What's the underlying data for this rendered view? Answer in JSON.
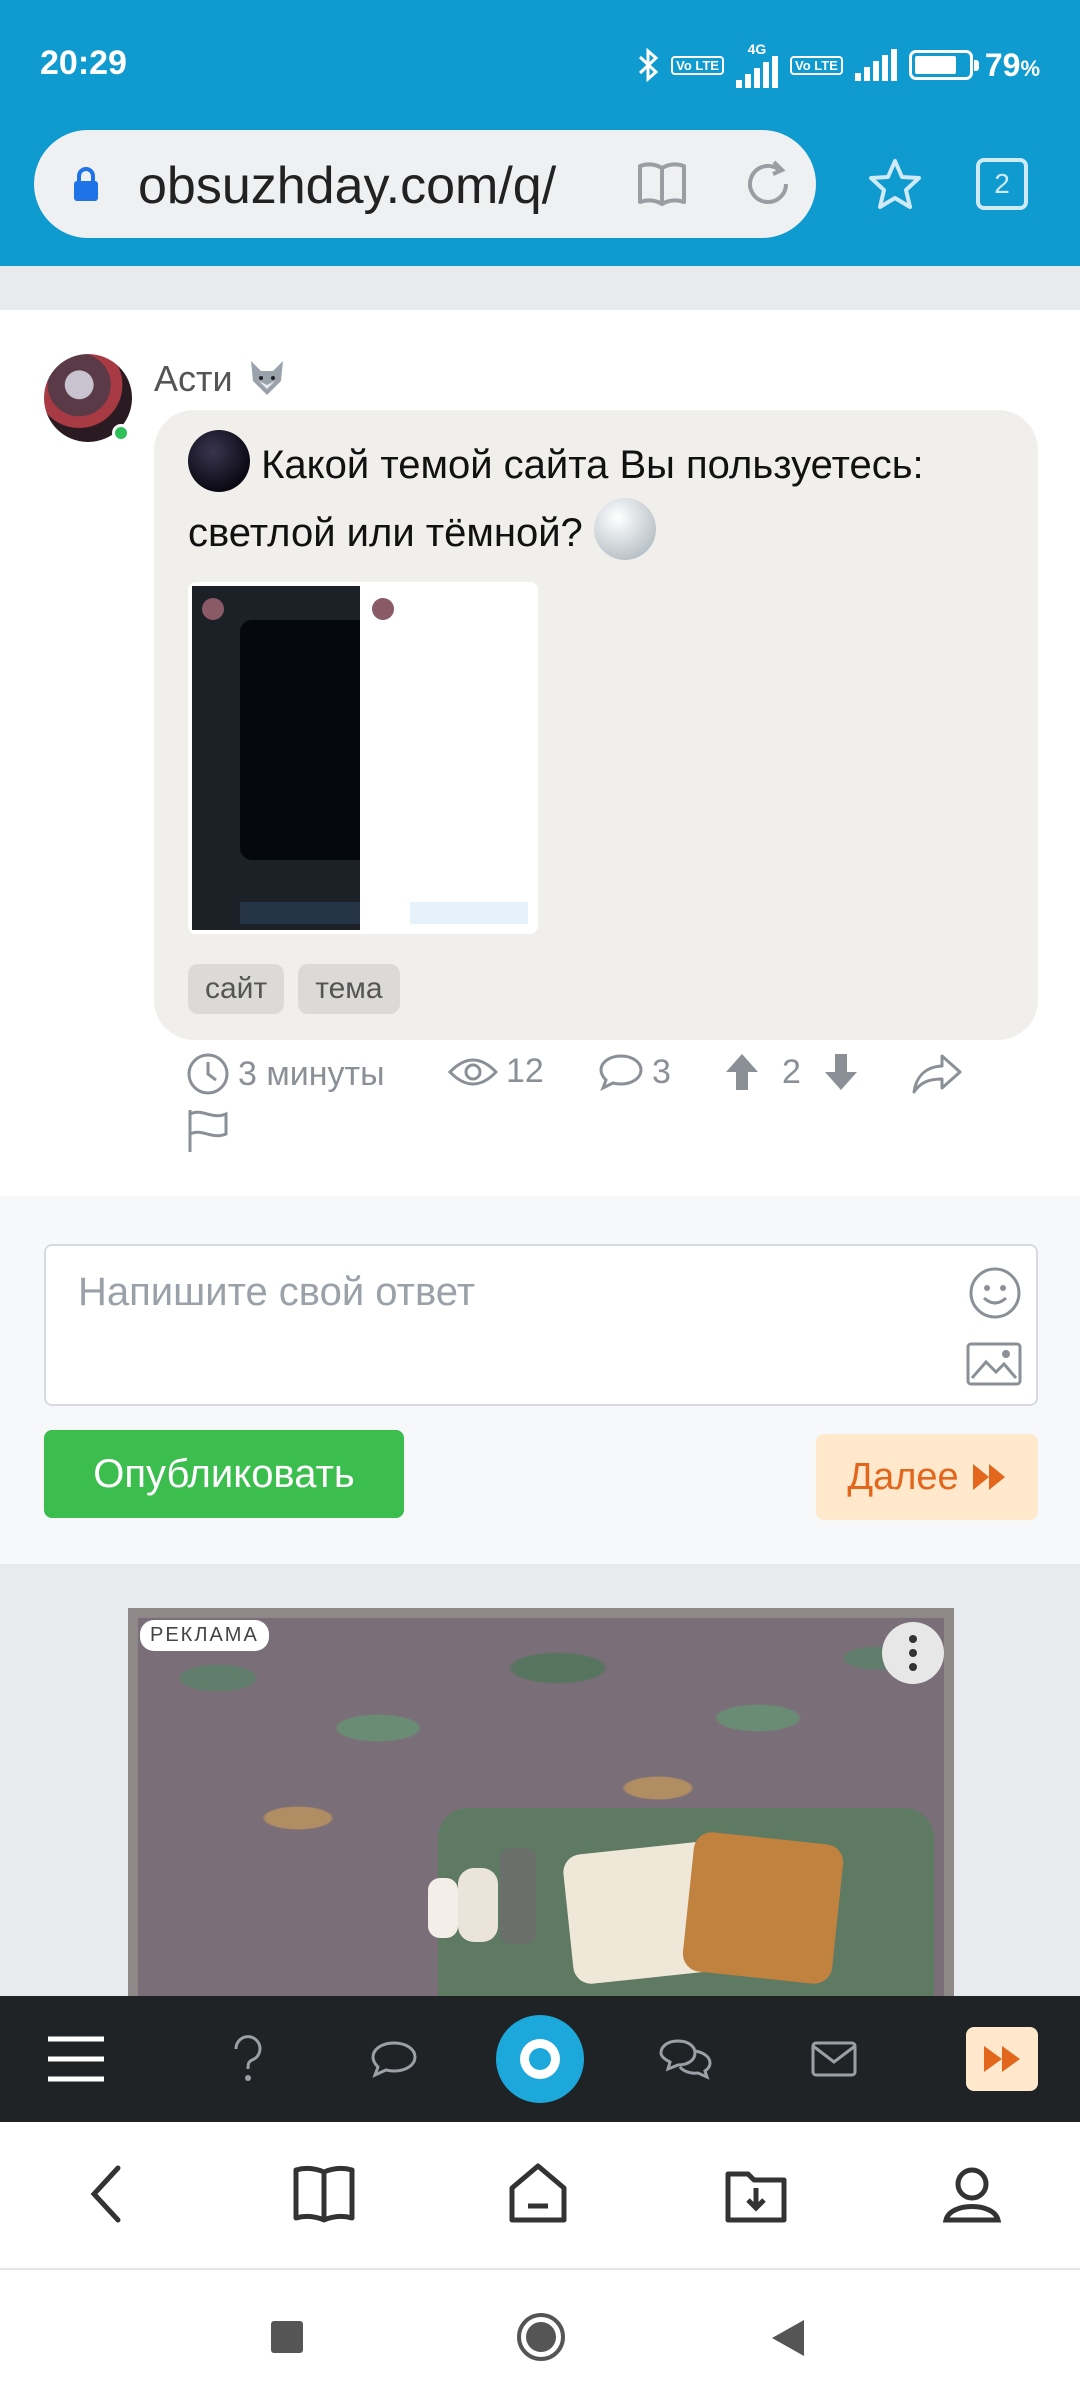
{
  "status_bar": {
    "time": "20:29",
    "battery": "79",
    "battery_unit": "%",
    "network_label": "4G",
    "volte_label": "Vo LTE"
  },
  "browser": {
    "url": "obsuzhday.com/q/",
    "tab_count": "2"
  },
  "post": {
    "author": "Асти",
    "question_text": "Какой темой сайта Вы пользуетесь: светлой или тёмной?",
    "tags": [
      "сайт",
      "тема"
    ],
    "meta": {
      "time_ago": "3 минуты",
      "views": "12",
      "comments": "3",
      "rating": "2"
    }
  },
  "answer_form": {
    "placeholder": "Напишите свой ответ",
    "publish_label": "Опубликовать",
    "next_label": "Далее"
  },
  "ad": {
    "label": "РЕКЛАМА"
  },
  "colors": {
    "browser_bar": "#0f9bd0",
    "publish_button": "#3cbe4f",
    "next_button_bg": "#ffe8cc",
    "next_button_text": "#e2661c",
    "site_nav_bg": "#202326"
  }
}
